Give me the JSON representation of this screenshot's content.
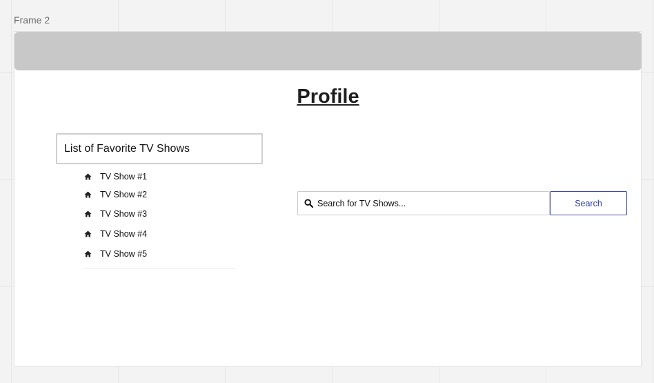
{
  "frame": {
    "label": "Frame 2"
  },
  "page": {
    "title": "Profile"
  },
  "favorites": {
    "header": "List of Favorite TV Shows",
    "items": [
      {
        "label": "TV Show #1",
        "icon": "home-icon"
      },
      {
        "label": "TV Show #2",
        "icon": "home-icon"
      },
      {
        "label": "TV Show #3",
        "icon": "home-icon"
      },
      {
        "label": "TV Show #4",
        "icon": "home-icon"
      },
      {
        "label": "TV Show #5",
        "icon": "home-icon"
      }
    ]
  },
  "search": {
    "placeholder": "Search for TV Shows...",
    "value": "",
    "icon": "search-icon",
    "button_label": "Search"
  },
  "colors": {
    "top_bar": "#c8c8c8",
    "button_accent": "#2d3a9e",
    "canvas_background": "#f3f3f3"
  }
}
